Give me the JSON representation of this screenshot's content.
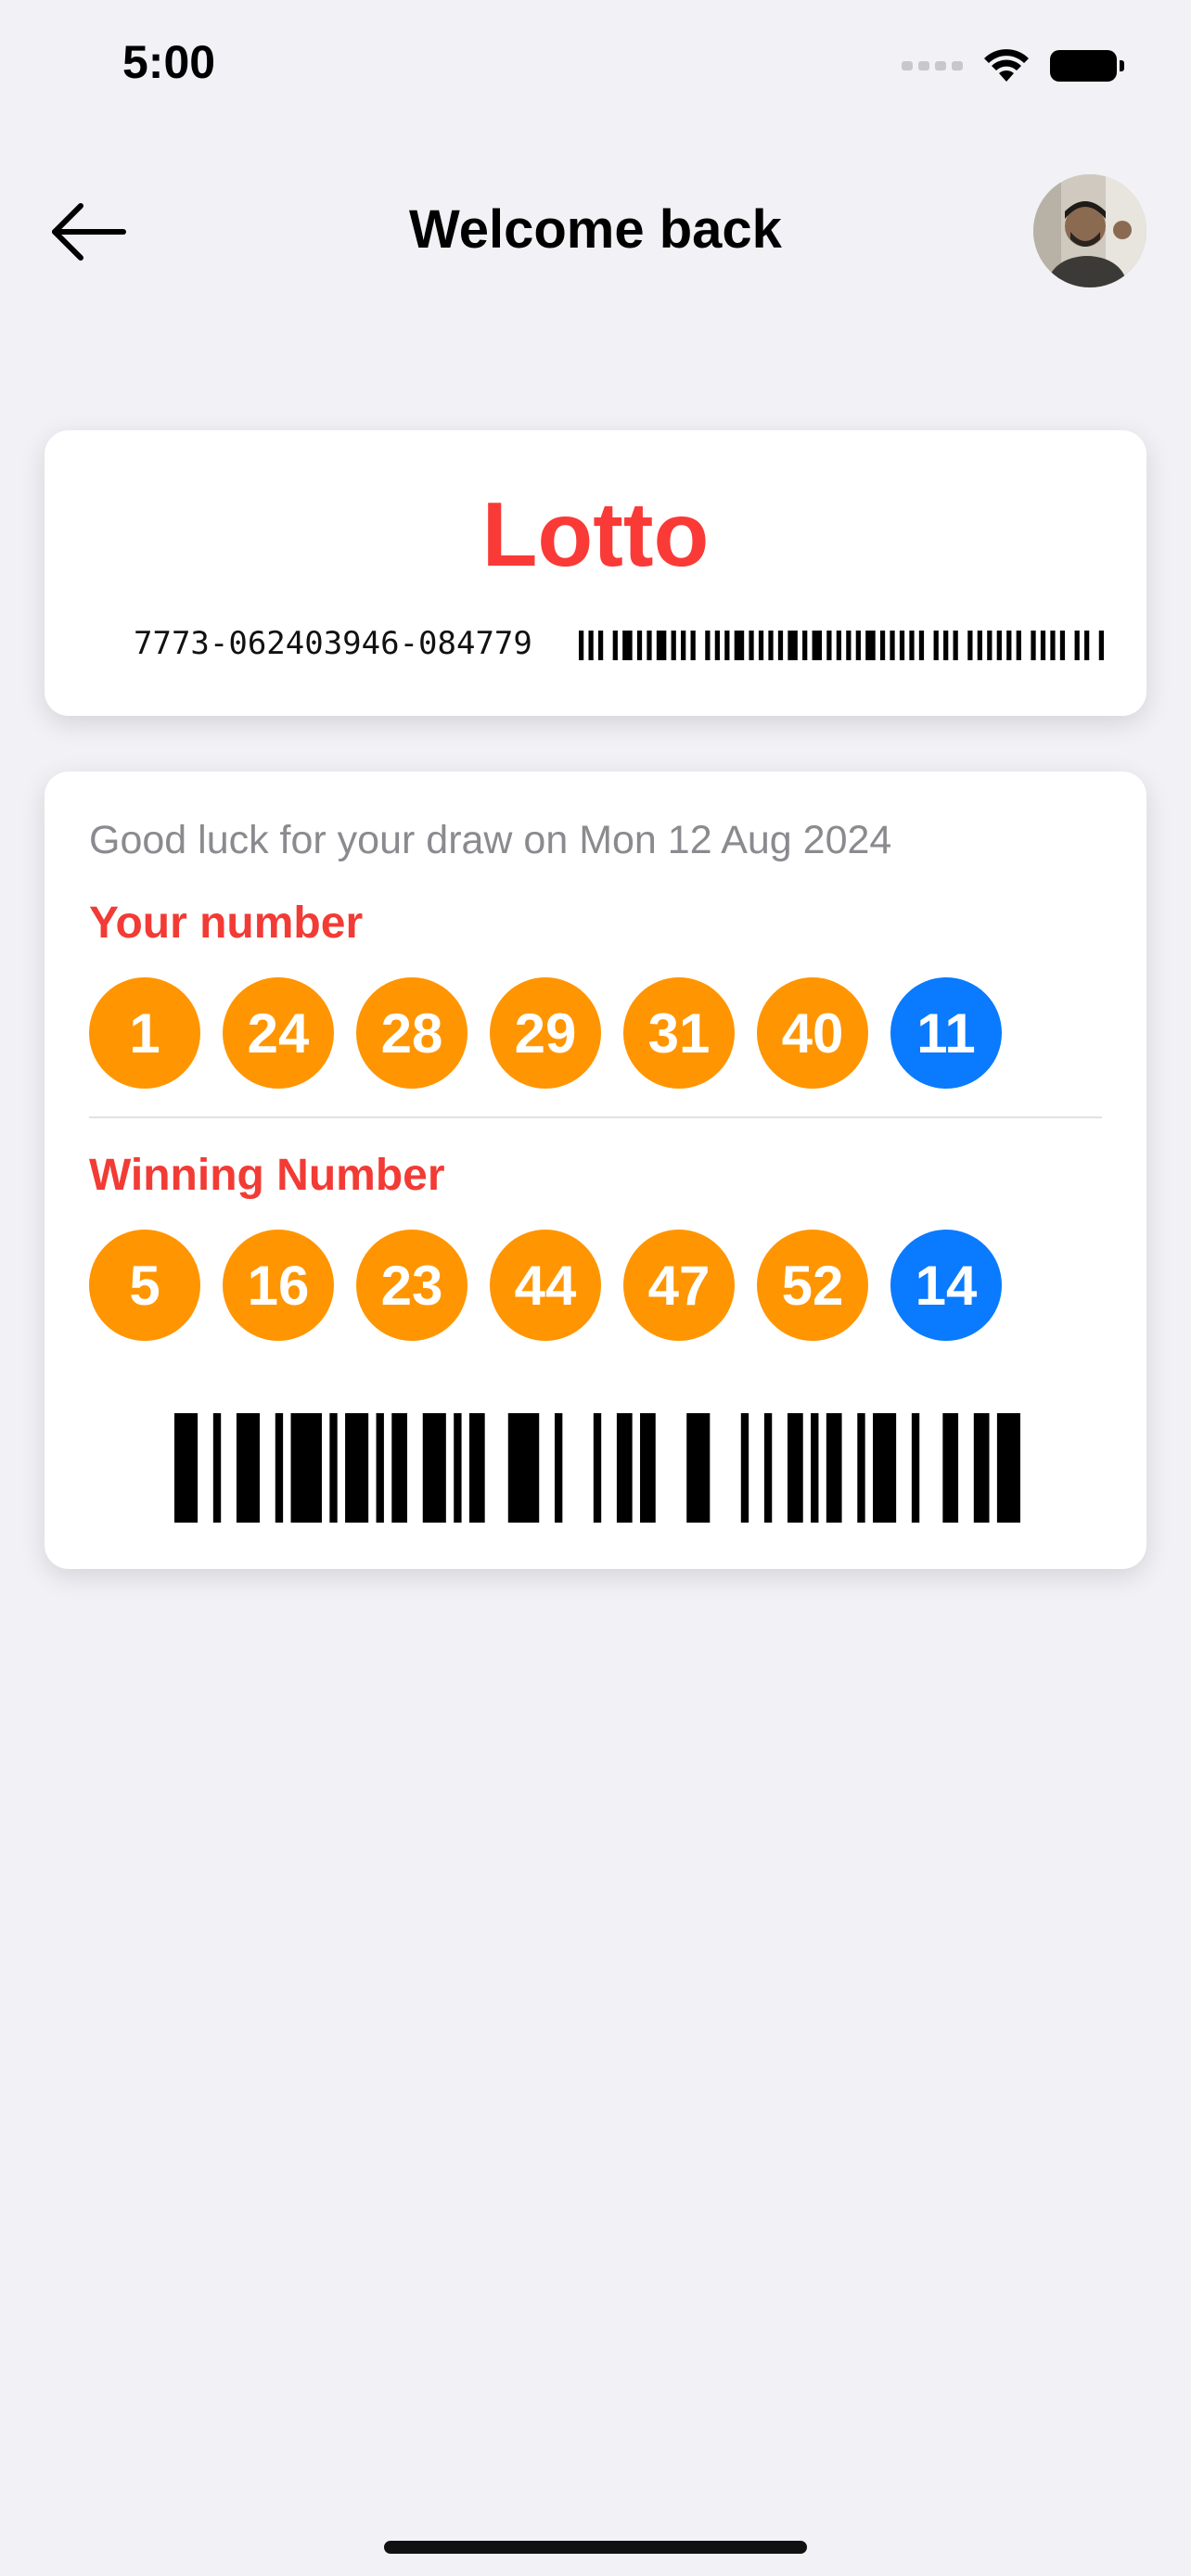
{
  "status_bar": {
    "time": "5:00",
    "icons": [
      "signal-dots-icon",
      "wifi-icon",
      "battery-icon"
    ]
  },
  "nav": {
    "title": "Welcome back",
    "back_icon": "arrow-left-icon",
    "avatar": "user-avatar"
  },
  "ticket": {
    "title": "Lotto",
    "serial": "7773-062403946-084779"
  },
  "draw": {
    "info": "Good luck for your draw on Mon 12 Aug 2024",
    "your_label": "Your number",
    "your_numbers": [
      "1",
      "24",
      "28",
      "29",
      "31",
      "40"
    ],
    "your_bonus": "11",
    "winning_label": "Winning Number",
    "winning_numbers": [
      "5",
      "16",
      "23",
      "44",
      "47",
      "52"
    ],
    "winning_bonus": "14"
  },
  "colors": {
    "accent_red": "#fa3a36",
    "ball_orange": "#ff9500",
    "ball_blue": "#0a7aff",
    "background": "#f1f1f6"
  }
}
